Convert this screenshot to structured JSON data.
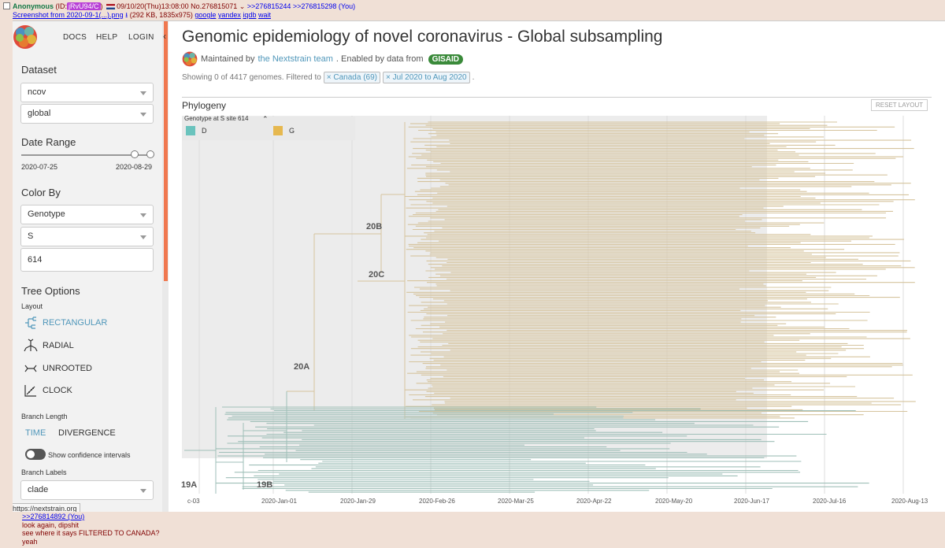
{
  "post": {
    "name": "Anonymous",
    "id_prefix": "(ID:",
    "id_value": "jRvU94/C",
    "id_suffix": ")",
    "datetime": "09/10/20(Thu)13:08:00",
    "number": "No.276815071",
    "replies": ">>276815244 >>276815298 (You)",
    "file_link": "Screenshot from 2020-09-1(...).png",
    "file_info": "(292 KB, 1835x975)",
    "search_links": [
      "google",
      "yandex",
      "iqdb",
      "wait"
    ],
    "reply_quote": ">>276814892 (You)",
    "reply_lines": [
      "look again, dipshit",
      "see where it says FILTERED TO CANADA?",
      "yeah"
    ]
  },
  "nav": {
    "docs": "DOCS",
    "help": "HELP",
    "login": "LOGIN"
  },
  "sidebar": {
    "dataset_title": "Dataset",
    "dataset_values": [
      "ncov",
      "global"
    ],
    "date_range_title": "Date Range",
    "date_start": "2020-07-25",
    "date_end": "2020-08-29",
    "color_by_title": "Color By",
    "color_by_values": [
      "Genotype",
      "S"
    ],
    "site_input": "614",
    "tree_options_title": "Tree Options",
    "layout_label": "Layout",
    "layouts": [
      "RECTANGULAR",
      "RADIAL",
      "UNROOTED",
      "CLOCK"
    ],
    "branch_length_label": "Branch Length",
    "branch_time": "TIME",
    "branch_divergence": "DIVERGENCE",
    "confidence_label": "Show confidence intervals",
    "branch_labels_label": "Branch Labels",
    "branch_labels_value": "clade",
    "url_tooltip": "https://nextstrain.org"
  },
  "main": {
    "title": "Genomic epidemiology of novel coronavirus - Global subsampling",
    "maintained_prefix": "Maintained by",
    "maintained_link": "the Nextstrain team",
    "enabled_text": ". Enabled by data from",
    "gisaid": "GISAID",
    "showing": "Showing 0 of 4417 genomes. Filtered to",
    "filters": [
      "× Canada (69)",
      "× Jul 2020 to Aug 2020"
    ],
    "period": ".",
    "phylogeny_title": "Phylogeny",
    "reset_layout": "RESET LAYOUT",
    "legend_title": "Genotype at S site 614",
    "legend": [
      {
        "label": "D",
        "color": "#6ac3bd"
      },
      {
        "label": "G",
        "color": "#e6b84f"
      }
    ],
    "clade_labels": [
      "20B",
      "20C",
      "20A",
      "19A",
      "19B"
    ],
    "x_ticks": [
      "c-03",
      "2020-Jan-01",
      "2020-Jan-29",
      "2020-Feb-26",
      "2020-Mar-25",
      "2020-Apr-22",
      "2020-May-20",
      "2020-Jun-17",
      "2020-Jul-16",
      "2020-Aug-13"
    ],
    "branch_colors": {
      "G": "#d6c49e",
      "D": "#9fbfb8"
    }
  }
}
